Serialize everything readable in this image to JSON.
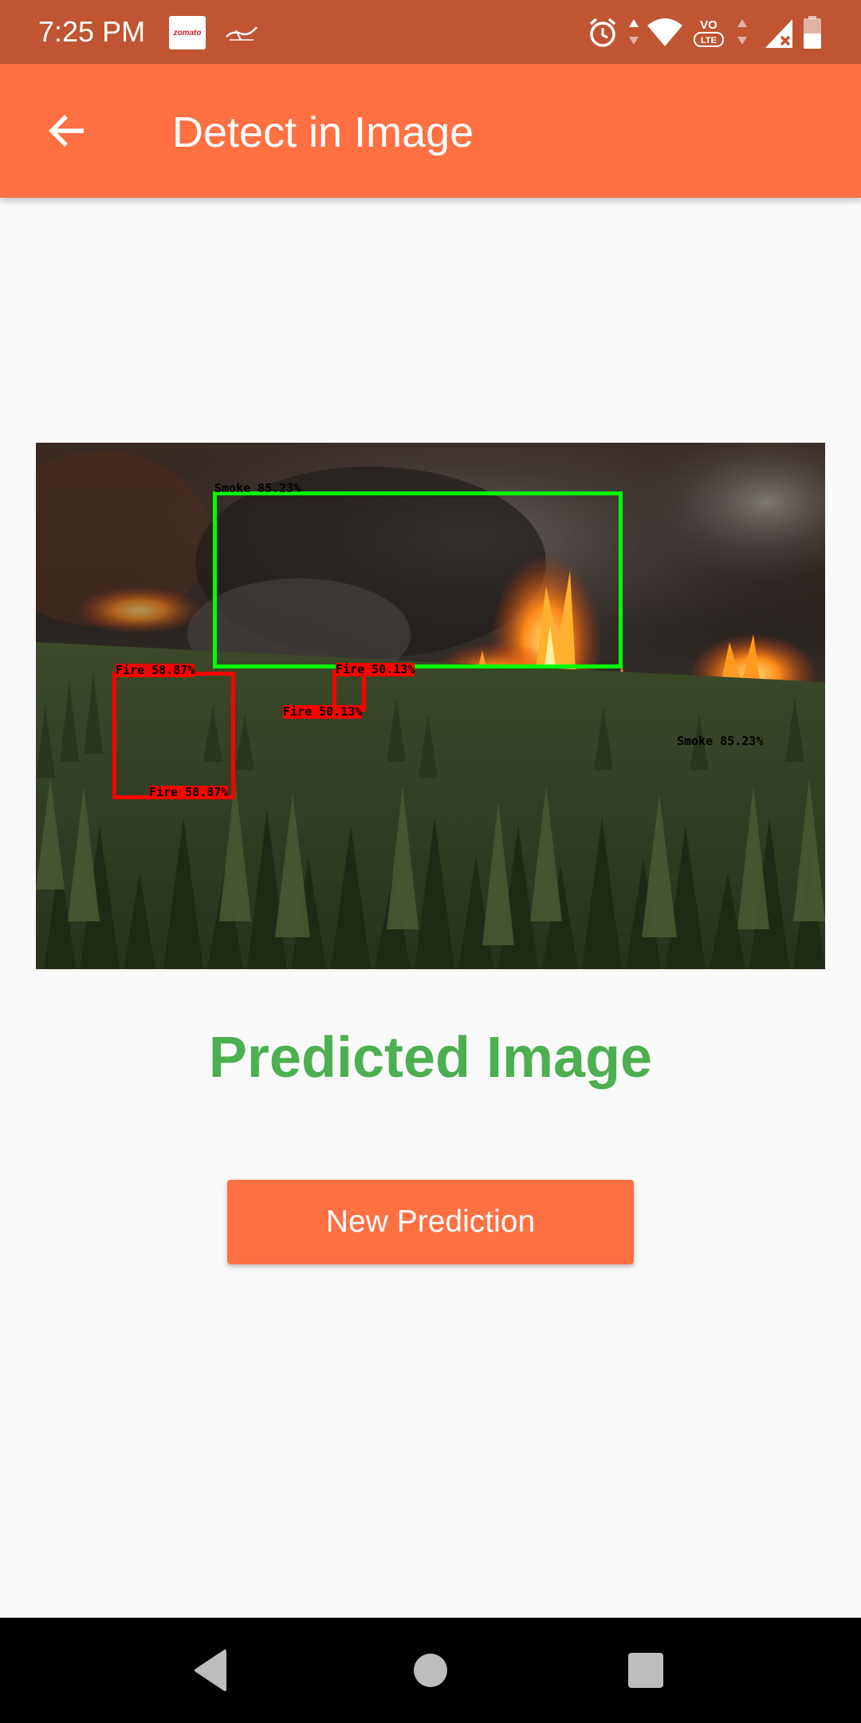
{
  "status_bar": {
    "time": "7:25 PM",
    "zomato_label": "zomato",
    "icons": [
      "zomato-notification-icon",
      "sf-notification-icon",
      "alarm-icon",
      "data-arrows-icon",
      "wifi-icon",
      "volte-icon",
      "signal-icon",
      "battery-icon"
    ],
    "volte_label": "VO",
    "lte_label": "LTE"
  },
  "app_bar": {
    "title": "Detect in Image",
    "back_icon": "arrow-back-icon",
    "color": "#ff7043"
  },
  "image": {
    "detections": [
      {
        "class": "Smoke",
        "confidence": "85.23%",
        "top_label": "Smoke 85.23%",
        "bottom_label": "Smoke 85.23%",
        "color": "#00ff00"
      },
      {
        "class": "Fire",
        "confidence": "58.87%",
        "top_label": "Fire 58.87%",
        "bottom_label": "Fire 58.87%",
        "color": "#ff0000"
      },
      {
        "class": "Fire",
        "confidence": "50.13%",
        "top_label": "Fire 50.13%",
        "bottom_label": "Fire 50.13%",
        "color": "#ff0000"
      }
    ]
  },
  "result": {
    "caption": "Predicted Image",
    "caption_color": "#4caf50"
  },
  "actions": {
    "new_prediction_label": "New Prediction",
    "button_color": "#ff7043"
  },
  "nav_bar": {
    "buttons": [
      "back-triangle-icon",
      "home-circle-icon",
      "recents-square-icon"
    ]
  }
}
